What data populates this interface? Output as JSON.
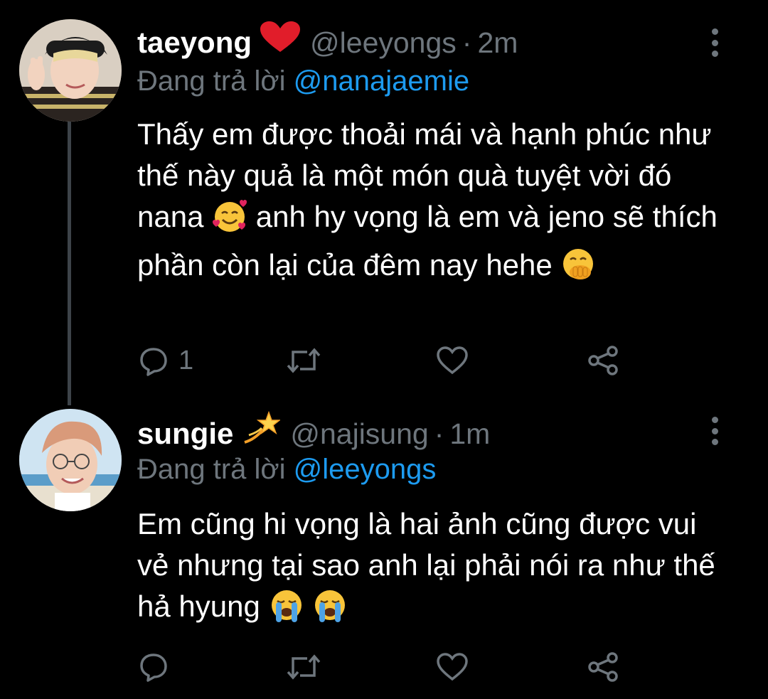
{
  "tweets": [
    {
      "display_name": "taeyong",
      "badge_icon": "red-heart-emoji",
      "handle": "@leeyongs",
      "separator": "·",
      "time": "2m",
      "replying_prefix": "Đang trả lời",
      "replying_to": "@nanajaemie",
      "text_parts": {
        "a": "Thấy em được thoải mái và hạnh phúc như thế này quả là một món quà tuyệt vời đó nana",
        "b": "anh hy vọng là em và jeno sẽ thích phần còn lại của đêm nay hehe"
      },
      "emojis": [
        "smiling-face-with-hearts",
        "face-with-hand-over-mouth"
      ],
      "reply_count": "1",
      "retweet_count": "",
      "like_count": ""
    },
    {
      "display_name": "sungie",
      "badge_icon": "dizzy-star-emoji",
      "handle": "@najisung",
      "separator": "·",
      "time": "1m",
      "replying_prefix": "Đang trả lời",
      "replying_to": "@leeyongs",
      "text_parts": {
        "a": "Em cũng hi vọng là hai ảnh cũng được vui vẻ nhưng tại sao anh lại phải nói ra như thế hả hyung"
      },
      "emojis": [
        "loudly-crying-face",
        "loudly-crying-face"
      ],
      "reply_count": "",
      "retweet_count": "",
      "like_count": ""
    }
  ],
  "colors": {
    "background": "#000000",
    "text": "#ffffff",
    "secondary": "#6e767d",
    "mention": "#1d9bf0",
    "thread_line": "#3d4349"
  }
}
